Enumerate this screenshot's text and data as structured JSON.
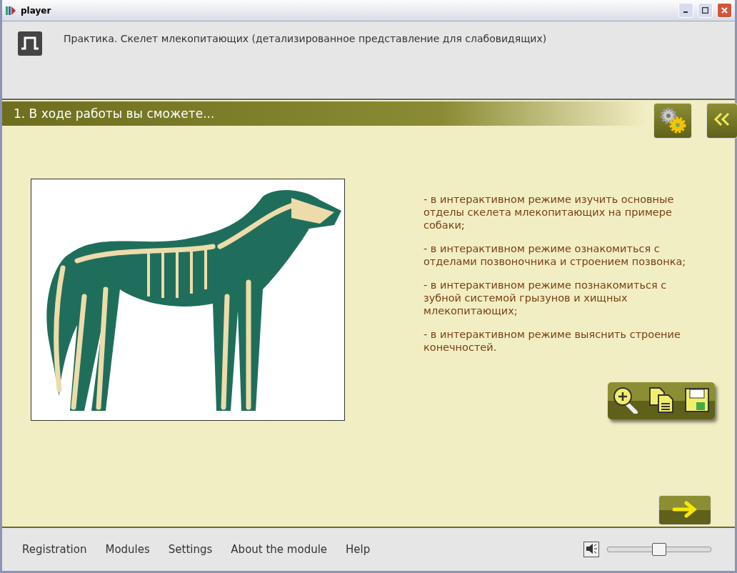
{
  "window": {
    "title": "player"
  },
  "header": {
    "title": "Практика. Скелет млекопитающих (детализированное представление для слабовидящих)"
  },
  "section": {
    "title": "1. В ходе работы вы сможете..."
  },
  "goals": [
    "- в интерактивном режиме изучить основные отделы скелета млекопитающих на примере собаки;",
    "- в интерактивном режиме ознакомиться с отделами позвоночника и строением позвонка;",
    "- в интерактивном режиме познакомиться с зубной системой грызунов и хищных млекопитающих;",
    "- в интерактивном режиме выяснить строение конечностей."
  ],
  "footer": {
    "menu": [
      "Registration",
      "Modules",
      "Settings",
      "About the module",
      "Help"
    ],
    "volume": {
      "level": 0.5
    }
  }
}
